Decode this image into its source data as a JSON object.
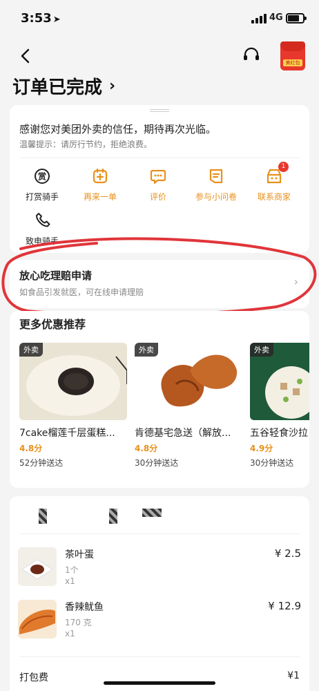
{
  "status_bar": {
    "time": "3:53",
    "network": "4G"
  },
  "header": {
    "title": "订单已完成",
    "title_chevron": "›",
    "redpacket_label": "美红包"
  },
  "thanks_card": {
    "message": "感谢您对美团外卖的信任，期待再次光临。",
    "tip": "温馨提示：请厉行节约，拒绝浪费。",
    "actions": [
      {
        "label": "打赏骑手",
        "icon": "tip-rider-icon",
        "style": "dark"
      },
      {
        "label": "再来一单",
        "icon": "reorder-icon",
        "style": "orange"
      },
      {
        "label": "评价",
        "icon": "review-icon",
        "style": "orange"
      },
      {
        "label": "参与小问卷",
        "icon": "survey-icon",
        "style": "orange"
      },
      {
        "label": "联系商家",
        "icon": "merchant-icon",
        "style": "orange",
        "badge": "1"
      },
      {
        "label": "致电骑手",
        "icon": "phone-icon",
        "style": "dark"
      }
    ],
    "tip_glyph": "赏"
  },
  "claim": {
    "title": "放心吃理赔申请",
    "subtitle": "如食品引发就医，可在线申请理赔",
    "chevron": "›"
  },
  "recommend": {
    "title": "更多优惠推荐",
    "items": [
      {
        "tag": "外卖",
        "name": "7cake榴莲千层蛋糕...",
        "rating": "4.8分",
        "time": "52分钟送达"
      },
      {
        "tag": "外卖",
        "name": "肯德基宅急送（解放...",
        "rating": "4.8分",
        "time": "30分钟送达"
      },
      {
        "tag": "外卖",
        "name": "五谷轻食沙拉",
        "rating": "4.9分",
        "time": "30分钟送达"
      }
    ]
  },
  "order": {
    "items": [
      {
        "name": "茶叶蛋",
        "spec": "1个",
        "qty": "x1",
        "price": "¥ 2.5"
      },
      {
        "name": "香辣鱿鱼",
        "spec": "170 克",
        "qty": "x1",
        "price": "¥ 12.9"
      }
    ],
    "packaging_label": "打包费",
    "packaging_price": "¥1"
  },
  "colors": {
    "accent": "#e8901a",
    "red": "#e8372c",
    "annotation": "#e0353a"
  }
}
